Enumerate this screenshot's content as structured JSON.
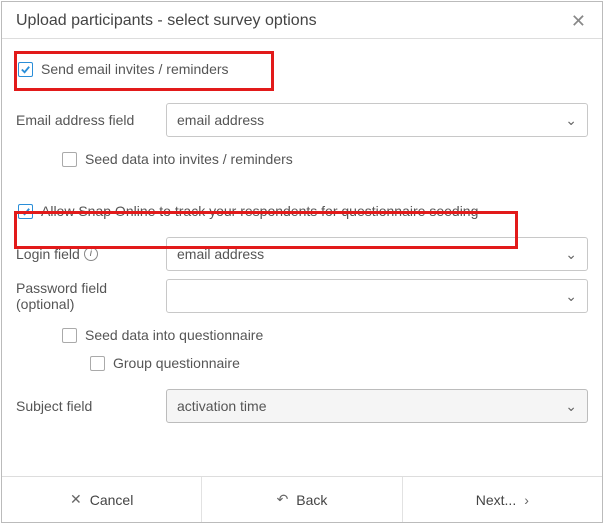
{
  "dialog": {
    "title": "Upload participants - select survey options"
  },
  "sendInvites": {
    "label": "Send email invites / reminders",
    "emailFieldLabel": "Email address field",
    "emailFieldValue": "email address",
    "seedInvitesLabel": "Seed data into invites / reminders"
  },
  "tracking": {
    "label": "Allow Snap Online to track your respondents for questionnaire seeding",
    "loginFieldLabel": "Login field",
    "loginFieldValue": "email address",
    "passwordFieldLabel": "Password field (optional)",
    "passwordFieldValue": "",
    "seedQuestionnaireLabel": "Seed data into questionnaire",
    "groupQuestionnaireLabel": "Group questionnaire",
    "subjectFieldLabel": "Subject field",
    "subjectFieldValue": "activation time"
  },
  "buttons": {
    "cancel": "Cancel",
    "back": "Back",
    "next": "Next..."
  }
}
